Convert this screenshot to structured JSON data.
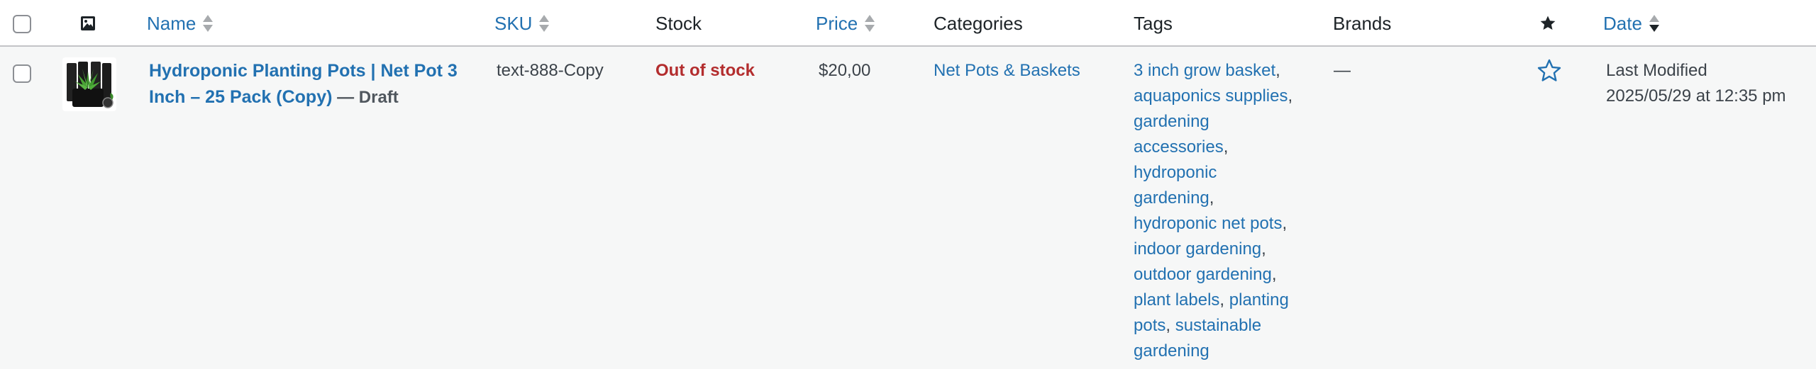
{
  "header": {
    "name_label": "Name",
    "sku_label": "SKU",
    "stock_label": "Stock",
    "price_label": "Price",
    "categories_label": "Categories",
    "tags_label": "Tags",
    "brands_label": "Brands",
    "date_label": "Date",
    "image_icon": "image-icon",
    "featured_icon": "star-filled-icon"
  },
  "product": {
    "name_line1": "Hydroponic Planting Pots | Net Pot 3",
    "name_line2": "Inch – 25 Pack (Copy)",
    "status": "— Draft",
    "sku": "text-888-Copy",
    "stock": "Out of stock",
    "price": "$20,00",
    "category": "Net Pots & Baskets",
    "brands": "—",
    "date_label": "Last Modified",
    "date_value": "2025/05/29 at 12:35 pm",
    "featured_icon": "star-outline-icon",
    "tags": [
      "3 inch grow basket",
      "aquaponics supplies",
      "gardening accessories",
      "hydroponic gardening",
      "hydroponic net pots",
      "indoor gardening",
      "outdoor gardening",
      "plant labels",
      "planting pots",
      "sustainable gardening"
    ],
    "tag_lines": [
      [
        "3 inch grow basket",
        ","
      ],
      [
        "aquaponics supplies",
        ","
      ],
      [
        "gardening",
        ""
      ],
      [
        "accessories",
        ","
      ],
      [
        "hydroponic",
        ""
      ],
      [
        "gardening",
        ","
      ],
      [
        "hydroponic net pots",
        ","
      ],
      [
        "indoor gardening",
        ","
      ],
      [
        "outdoor gardening",
        ","
      ],
      [
        "plant labels",
        ", ",
        "planting"
      ],
      [
        "pots",
        ", ",
        "sustainable"
      ],
      [
        "gardening",
        ""
      ]
    ]
  },
  "colors": {
    "link": "#2271b1",
    "out_of_stock": "#b32d2e",
    "header_bg": "#ffffff",
    "row_bg": "#f6f7f7"
  }
}
